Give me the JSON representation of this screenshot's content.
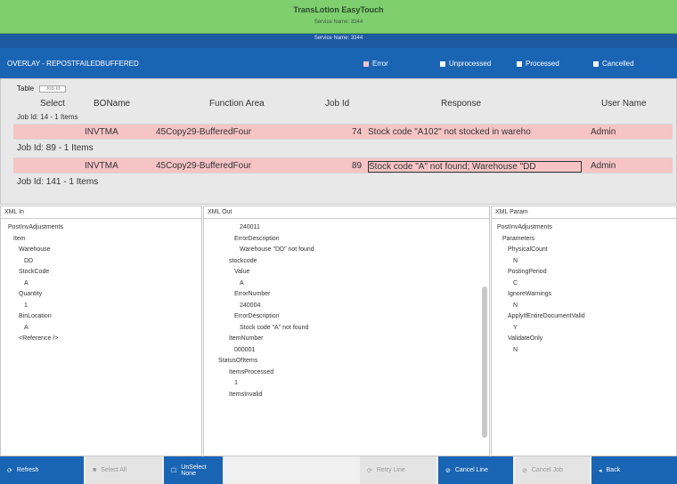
{
  "titlebar": {
    "title": "TransLotion EasyTouch",
    "subtitle": "Service Name: 3344"
  },
  "toolbar": {
    "text": "Service Name: 3344"
  },
  "overlay": {
    "label": "OVERLAY - REPOSTFAILEDBUFFERED",
    "legend": [
      {
        "label": "Error",
        "color": "#f7c4c6"
      },
      {
        "label": "Unprocessed",
        "color": "#ffffff"
      },
      {
        "label": "Processed",
        "color": "#ffffff"
      },
      {
        "label": "Cancelled",
        "color": "#ffffff"
      }
    ]
  },
  "grid": {
    "table_label": "Table",
    "table_select": "Job Id",
    "columns": [
      "Select",
      "BOName",
      "Function Area",
      "Job Id",
      "Response",
      "User Name"
    ],
    "rows": [
      {
        "group": "Job Id: 14 - 1 Items"
      },
      {
        "select": "",
        "boname": "INVTMA",
        "function_area": "45Copy29-BufferedFour",
        "job_id": "74",
        "response": "Stock code \"A102\" not stocked in wareho",
        "user": "Admin"
      },
      {
        "group": "Job Id: 89 - 1 Items"
      },
      {
        "select": "",
        "boname": "INVTMA",
        "function_area": "45Copy29-BufferedFour",
        "job_id": "89",
        "response": "Stock code \"A\" not found; Warehouse \"DD",
        "user": "Admin"
      },
      {
        "group": "Job Id: 141 - 1 Items"
      }
    ]
  },
  "panels": {
    "xml_in": {
      "title": "XML In",
      "lines": [
        "PostInvAdjustments",
        "Item",
        "Warehouse",
        "DD",
        "StockCode",
        "A",
        "Quantity",
        "1",
        "BinLocation",
        "A",
        "<Reference />"
      ]
    },
    "xml_out": {
      "title": "XML Out",
      "lines": [
        "240011",
        "ErrorDescription",
        "Warehouse \"DD\" not found",
        "stockcode",
        "Value",
        "A",
        "ErrorNumber",
        "240004",
        "ErrorDescription",
        "Stock code \"A\" not found",
        "ItemNumber",
        "000001",
        "StatusOfItems",
        "ItemsProcessed",
        "1",
        "ItemsInvalid"
      ]
    },
    "xml_param": {
      "title": "XML Param",
      "lines": [
        "PostInvAdjustments",
        "Parameters",
        "PhysicalCount",
        "N",
        "PostingPeriod",
        "C",
        "IgnoreWarnings",
        "N",
        "ApplyIfEntireDocumentValid",
        "Y",
        "ValidateOnly",
        "N"
      ]
    }
  },
  "bottom": {
    "refresh": "Refresh",
    "select_all": "Select All",
    "unselect": "UnSelect None",
    "retry": "Retry Line",
    "cancel_line": "Cancel Line",
    "cancel_job": "Cancel Job",
    "back": "Back"
  }
}
